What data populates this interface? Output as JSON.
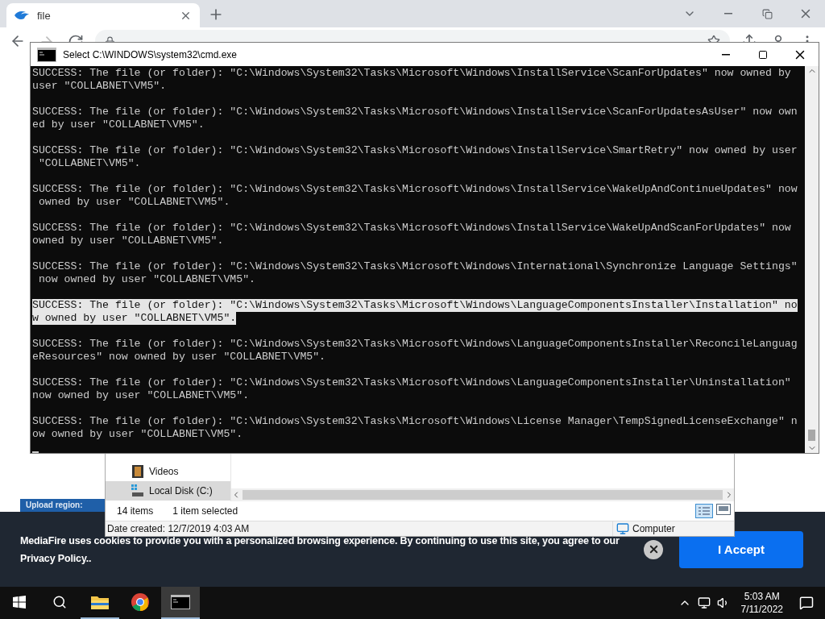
{
  "browser": {
    "tab": {
      "title": "file"
    }
  },
  "console": {
    "title": "Select C:\\WINDOWS\\system32\\cmd.exe",
    "entries": [
      {
        "selected": false,
        "lines": [
          "SUCCESS: The file (or folder): \"C:\\Windows\\System32\\Tasks\\Microsoft\\Windows\\InstallService\\ScanForUpdates\" now owned by",
          "user \"COLLABNET\\VM5\"."
        ]
      },
      {
        "selected": false,
        "lines": [
          "SUCCESS: The file (or folder): \"C:\\Windows\\System32\\Tasks\\Microsoft\\Windows\\InstallService\\ScanForUpdatesAsUser\" now own",
          "ed by user \"COLLABNET\\VM5\"."
        ]
      },
      {
        "selected": false,
        "lines": [
          "SUCCESS: The file (or folder): \"C:\\Windows\\System32\\Tasks\\Microsoft\\Windows\\InstallService\\SmartRetry\" now owned by user",
          " \"COLLABNET\\VM5\"."
        ]
      },
      {
        "selected": false,
        "lines": [
          "SUCCESS: The file (or folder): \"C:\\Windows\\System32\\Tasks\\Microsoft\\Windows\\InstallService\\WakeUpAndContinueUpdates\" now",
          " owned by user \"COLLABNET\\VM5\"."
        ]
      },
      {
        "selected": false,
        "lines": [
          "SUCCESS: The file (or folder): \"C:\\Windows\\System32\\Tasks\\Microsoft\\Windows\\InstallService\\WakeUpAndScanForUpdates\" now",
          "owned by user \"COLLABNET\\VM5\"."
        ]
      },
      {
        "selected": false,
        "lines": [
          "SUCCESS: The file (or folder): \"C:\\Windows\\System32\\Tasks\\Microsoft\\Windows\\International\\Synchronize Language Settings\"",
          " now owned by user \"COLLABNET\\VM5\"."
        ]
      },
      {
        "selected": true,
        "lines": [
          "SUCCESS: The file (or folder): \"C:\\Windows\\System32\\Tasks\\Microsoft\\Windows\\LanguageComponentsInstaller\\Installation\" no",
          "w owned by user \"COLLABNET\\VM5\"."
        ]
      },
      {
        "selected": false,
        "lines": [
          "SUCCESS: The file (or folder): \"C:\\Windows\\System32\\Tasks\\Microsoft\\Windows\\LanguageComponentsInstaller\\ReconcileLanguag",
          "eResources\" now owned by user \"COLLABNET\\VM5\"."
        ]
      },
      {
        "selected": false,
        "lines": [
          "SUCCESS: The file (or folder): \"C:\\Windows\\System32\\Tasks\\Microsoft\\Windows\\LanguageComponentsInstaller\\Uninstallation\"",
          "now owned by user \"COLLABNET\\VM5\"."
        ]
      },
      {
        "selected": false,
        "lines": [
          "SUCCESS: The file (or folder): \"C:\\Windows\\System32\\Tasks\\Microsoft\\Windows\\License Manager\\TempSignedLicenseExchange\" n",
          "ow owned by user \"COLLABNET\\VM5\"."
        ]
      }
    ]
  },
  "file_dialog": {
    "nav_items": [
      {
        "kind": "videos",
        "label": "Videos",
        "selected": false
      },
      {
        "kind": "disk",
        "label": "Local Disk (C:)",
        "selected": true
      }
    ],
    "item_count": "14 items",
    "selection_count": "1 item selected",
    "details": "Date created: 12/7/2019 4:03 AM",
    "location": "Computer"
  },
  "page": {
    "upload_label": "Upload region:"
  },
  "cookie_banner": {
    "text": "MediaFire uses cookies to provide you with a personalized browsing experience. By continuing to use this site, you agree to our Privacy Policy..",
    "button": "I Accept"
  },
  "taskbar": {
    "apps": [
      {
        "kind": "explorer",
        "open": true,
        "active": false
      },
      {
        "kind": "chrome",
        "open": false,
        "active": false
      },
      {
        "kind": "console",
        "open": true,
        "active": true
      }
    ],
    "time": "5:03 AM",
    "date": "7/11/2022"
  }
}
